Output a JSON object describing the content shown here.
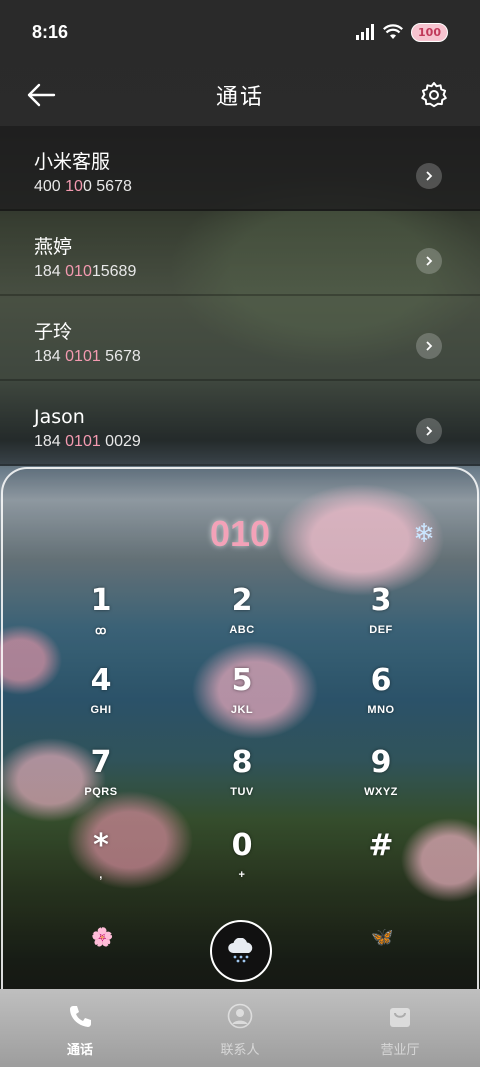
{
  "status_bar": {
    "time": "8:16",
    "battery": "100"
  },
  "header": {
    "title": "通话",
    "back_icon": "arrow-left-icon",
    "settings_icon": "gear-icon"
  },
  "contacts": [
    {
      "name": "小米客服",
      "num_pre": "400 ",
      "num_hl": "10",
      "num_post": "0 5678"
    },
    {
      "name": "燕婷",
      "num_pre": "184 ",
      "num_hl": "010",
      "num_post": "15689"
    },
    {
      "name": "子玲",
      "num_pre": "184 ",
      "num_hl": "0101",
      "num_post": " 5678"
    },
    {
      "name": "Jason",
      "num_pre": "184 ",
      "num_hl": "0101",
      "num_post": " 0029"
    }
  ],
  "dialpad": {
    "display": "010",
    "keys": [
      {
        "digit": "1",
        "letters": "ꝏ"
      },
      {
        "digit": "2",
        "letters": "ABC"
      },
      {
        "digit": "3",
        "letters": "DEF"
      },
      {
        "digit": "4",
        "letters": "GHI"
      },
      {
        "digit": "5",
        "letters": "JKL"
      },
      {
        "digit": "6",
        "letters": "MNO"
      },
      {
        "digit": "7",
        "letters": "PQRS"
      },
      {
        "digit": "8",
        "letters": "TUV"
      },
      {
        "digit": "9",
        "letters": "WXYZ"
      },
      {
        "digit": "*",
        "letters": ","
      },
      {
        "digit": "0",
        "letters": "+"
      },
      {
        "digit": "#",
        "letters": ""
      }
    ]
  },
  "tabs": [
    {
      "label": "通话",
      "icon": "phone-icon",
      "active": true
    },
    {
      "label": "联系人",
      "icon": "person-icon",
      "active": false
    },
    {
      "label": "营业厅",
      "icon": "bag-icon",
      "active": false
    }
  ],
  "colors": {
    "highlight": "#f39ab0",
    "display_digits": "#f3a2b8"
  }
}
